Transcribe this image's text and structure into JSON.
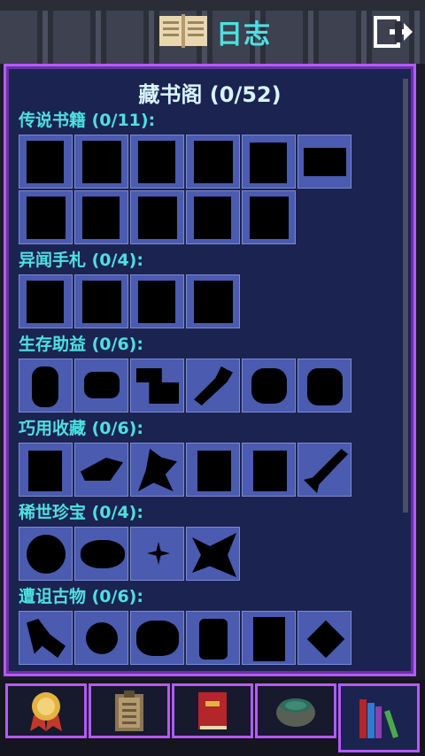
{
  "header": {
    "title": "日志"
  },
  "panel": {
    "title": "藏书阁 (0/52)"
  },
  "categories": [
    {
      "label": "传说书籍 (0/11):"
    },
    {
      "label": "异闻手札 (0/4):"
    },
    {
      "label": "生存助益 (0/6):"
    },
    {
      "label": "巧用收藏 (0/6):"
    },
    {
      "label": "稀世珍宝 (0/4):"
    },
    {
      "label": "遭诅古物 (0/6):"
    }
  ],
  "colors": {
    "accent": "#4fe0e0",
    "border": "#b05cff",
    "panel": "#1b2350",
    "slot": "#4a5bb0"
  },
  "tabs": [
    {
      "icon": "medal-icon"
    },
    {
      "icon": "clipboard-icon"
    },
    {
      "icon": "red-book-icon"
    },
    {
      "icon": "cauldron-icon"
    },
    {
      "icon": "bookshelf-icon",
      "active": true
    }
  ]
}
